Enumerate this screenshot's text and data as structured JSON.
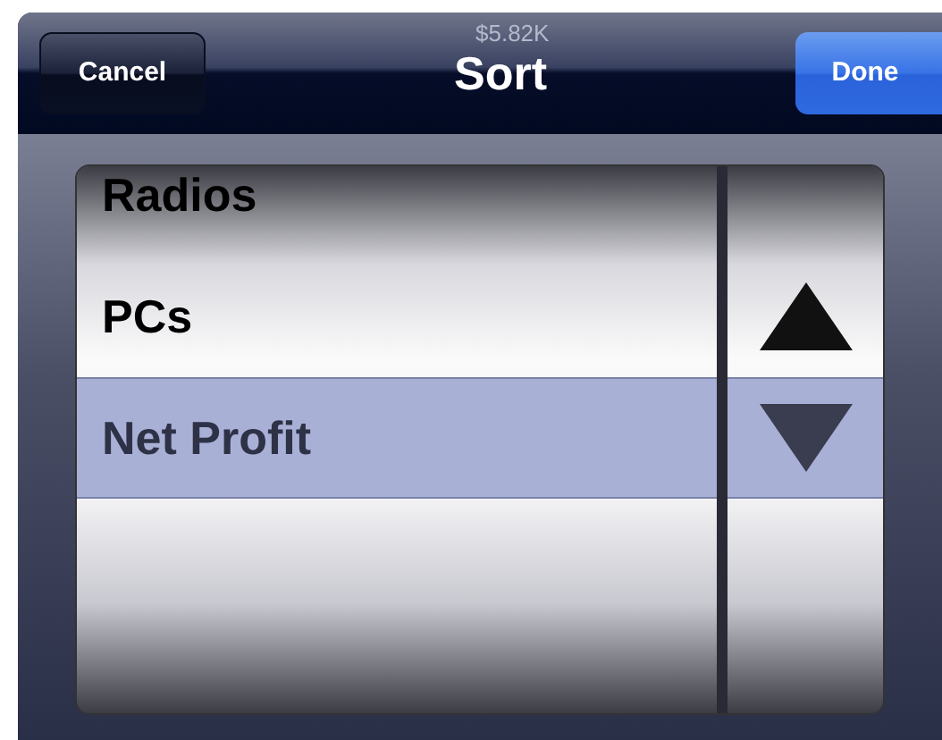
{
  "background_value": "$5.82K",
  "toolbar": {
    "cancel": "Cancel",
    "title": "Sort",
    "done": "Done"
  },
  "fields": [
    {
      "label": "Radios",
      "selected": false
    },
    {
      "label": "PCs",
      "selected": false
    },
    {
      "label": "Net Profit",
      "selected": true
    }
  ],
  "order": [
    {
      "kind": "ascending",
      "selected": false
    },
    {
      "kind": "descending",
      "selected": true
    }
  ]
}
